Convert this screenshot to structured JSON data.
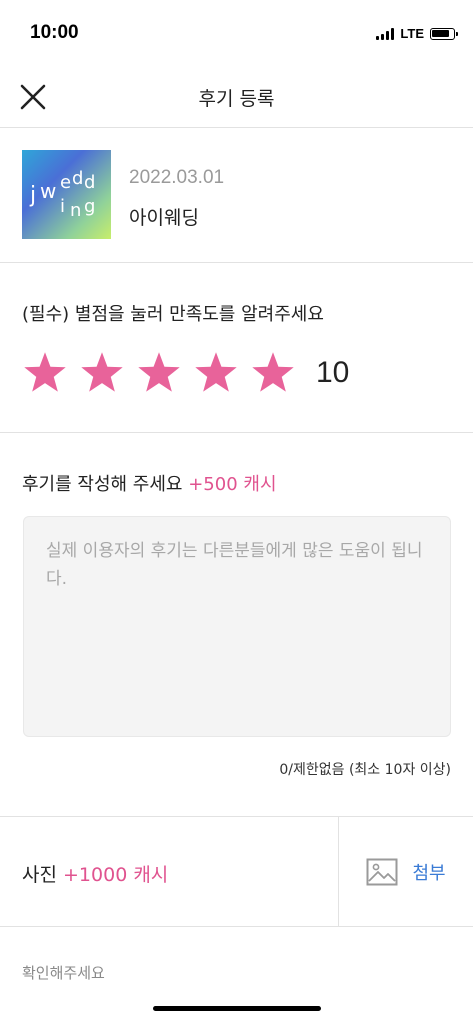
{
  "status_bar": {
    "time": "10:00",
    "network": "LTE"
  },
  "header": {
    "title": "후기 등록",
    "close_icon": "close-icon"
  },
  "product": {
    "logo_text": "jwedding",
    "date": "2022.03.01",
    "name": "아이웨딩"
  },
  "rating": {
    "label": "(필수) 별점을 눌러 만족도를 알려주세요",
    "stars": 5,
    "max_stars": 5,
    "score": "10",
    "star_color": "#e8639a"
  },
  "review": {
    "label": "후기를 작성해 주세요",
    "bonus": "+500 캐시",
    "value": "",
    "placeholder": "실제 이용자의 후기는 다른분들에게 많은 도움이 됩니다.",
    "char_count": "0/제한없음 (최소 10자 이상)"
  },
  "photo": {
    "label": "사진",
    "bonus": "+1000 캐시",
    "attach_label": "첨부",
    "attach_icon": "image-icon"
  },
  "footer": {
    "confirm_label": "확인해주세요"
  },
  "colors": {
    "accent_pink": "#e0538f",
    "link_blue": "#3a7bd5"
  }
}
